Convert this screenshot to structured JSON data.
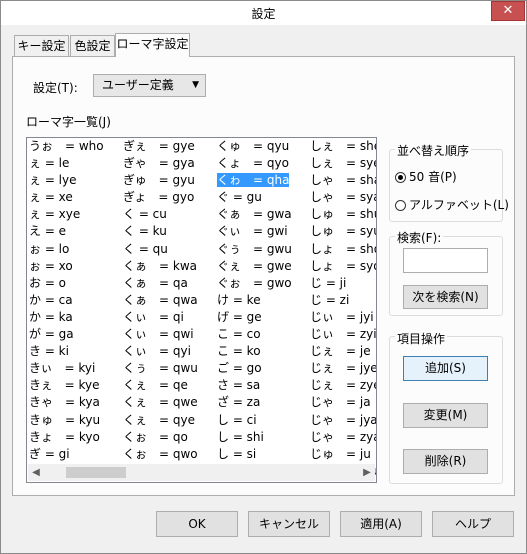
{
  "window": {
    "title": "設定",
    "close_glyph": "✕"
  },
  "tabs": [
    {
      "label": "キー設定"
    },
    {
      "label": "色設定"
    },
    {
      "label": "ローマ字設定"
    }
  ],
  "setting": {
    "label": "設定(T):",
    "value": "ユーザー定義",
    "arrow_glyph": "▼"
  },
  "list": {
    "label": "ローマ字一覧(J)",
    "columns": [
      [
        "うぉ　= who",
        "ぇ = le",
        "ぇ = lye",
        "ぇ = xe",
        "ぇ = xye",
        "え = e",
        "ぉ = lo",
        "ぉ = xo",
        "お = o",
        "か = ca",
        "か = ka",
        "が = ga",
        "き = ki",
        "きぃ　= kyi",
        "きぇ　= kye",
        "きゃ　= kya",
        "きゅ　= kyu",
        "きょ　= kyo",
        "ぎ = gi",
        "ぎぃ　= gyi"
      ],
      [
        "ぎぇ　= gye",
        "ぎゃ　= gya",
        "ぎゅ　= gyu",
        "ぎょ　= gyo",
        "く = cu",
        "く = ku",
        "く = qu",
        "くぁ　= kwa",
        "くぁ　= qa",
        "くぁ　= qwa",
        "くぃ　= qi",
        "くぃ　= qwi",
        "くぃ　= qyi",
        "くぅ　= qwu",
        "くぇ　= qe",
        "くぇ　= qwe",
        "くぇ　= qye",
        "くぉ　= qo",
        "くぉ　= qwo",
        "くゃ　= qya"
      ],
      [
        "くゅ　= qyu",
        "くょ　= qyo",
        "くゎ　= qha",
        "ぐ = gu",
        "ぐぁ　= gwa",
        "ぐぃ　= gwi",
        "ぐぅ　= gwu",
        "ぐぇ　= gwe",
        "ぐぉ　= gwo",
        "け = ke",
        "げ = ge",
        "こ = co",
        "こ = ko",
        "ご = go",
        "さ = sa",
        "ざ = za",
        "し = ci",
        "し = shi",
        "し = si",
        "しぃ　= syi"
      ],
      [
        "しぇ　= she",
        "しぇ　= sye",
        "しゃ　= sha",
        "しゃ　= sya",
        "しゅ　= shu",
        "しゅ　= syu",
        "しょ　= sho",
        "しょ　= syo",
        "じ = ji",
        "じ = zi",
        "じぃ　= jyi",
        "じぃ　= zyi",
        "じぇ　= je",
        "じぇ　= jye",
        "じぇ　= zye",
        "じゃ　= ja",
        "じゃ　= jya",
        "じゃ　= zya",
        "じゅ　= ju",
        "じゅ　= jyu"
      ]
    ],
    "scroll_left_glyph": "◀",
    "scroll_right_glyph": "▶"
  },
  "sort": {
    "title": "並べ替え順序",
    "options": [
      {
        "label": "50 音(P)",
        "checked": true
      },
      {
        "label": "アルファベット(L)",
        "checked": false
      }
    ]
  },
  "search": {
    "title": "検索(F):",
    "value": "",
    "button": "次を検索(N)"
  },
  "item_ops": {
    "title": "項目操作",
    "add": "追加(S)",
    "change": "変更(M)",
    "delete": "削除(R)"
  },
  "footer": {
    "ok": "OK",
    "cancel": "キャンセル",
    "apply": "適用(A)",
    "help": "ヘルプ"
  }
}
